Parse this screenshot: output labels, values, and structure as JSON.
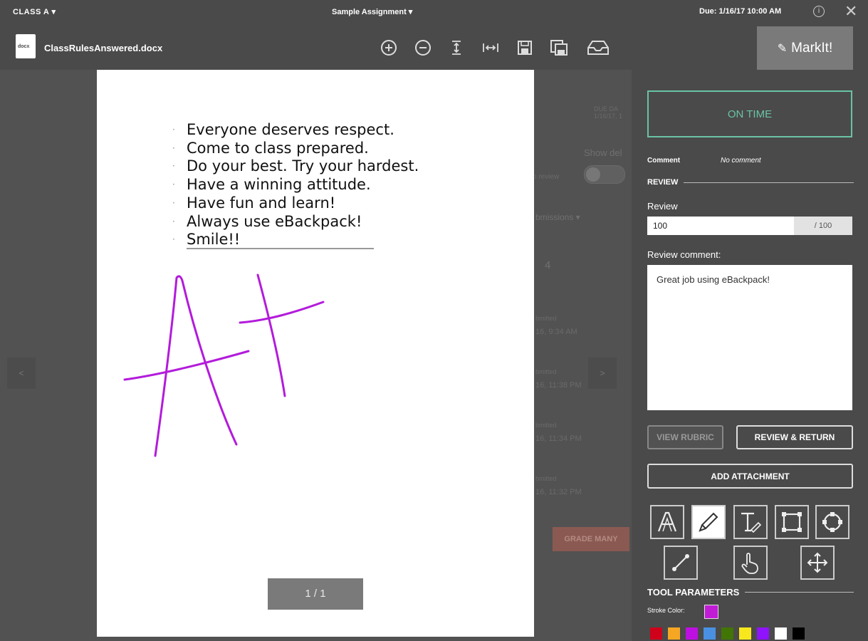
{
  "topbar": {
    "class_label": "CLASS A ▾",
    "assignment_label": "Sample Assignment ▾",
    "due_label": "Due: 1/16/17 10:00 AM",
    "info_glyph": "i",
    "close_glyph": "✕"
  },
  "toolbar": {
    "file_ext": "docx",
    "file_name": "ClassRulesAnswered.docx",
    "icons": [
      "zoom-in-icon",
      "zoom-out-icon",
      "fit-height-icon",
      "fit-width-icon",
      "save-icon",
      "save-copy-icon",
      "inbox-icon"
    ],
    "markit_label": "MarkIt!"
  },
  "background": {
    "due_date_header": "DUE DA",
    "due_date_value": "1/16/17, 1",
    "show_label": "Show del",
    "review_text": "o review",
    "submissions_label": "bmissions ▾",
    "count": "4",
    "items": [
      {
        "status": "bmitted",
        "time": "16, 9:34 AM"
      },
      {
        "status": "bmitted",
        "time": "16, 11:38 PM"
      },
      {
        "status": "bmitted",
        "time": "16, 11:34 PM"
      },
      {
        "status": "bmitted",
        "time": "16, 11:32 PM"
      }
    ],
    "grade_many_label": "GRADE MANY",
    "prev_glyph": "<",
    "next_glyph": ">"
  },
  "document": {
    "rules": [
      "Everyone deserves respect.",
      "Come to class prepared.",
      "Do your best.  Try your hardest.",
      "Have a winning attitude.",
      "Have fun and learn!",
      "Always use eBackpack!",
      " Smile!!"
    ],
    "ink_color": "#b31bdb",
    "pager": "1 / 1"
  },
  "panel": {
    "status": "ON TIME",
    "status_color": "#6ac3a3",
    "comment_label": "Comment",
    "comment_value": "No comment",
    "review_section": "REVIEW",
    "review_label": "Review",
    "review_value": "100",
    "review_max": "/ 100",
    "review_comment_label": "Review comment:",
    "review_comment_value": "Great job using eBackpack!",
    "view_rubric": "VIEW RUBRIC",
    "review_return": "REVIEW & RETURN",
    "add_attachment": "ADD ATTACHMENT",
    "tools": [
      "text-annotation-icon",
      "pencil-icon",
      "text-tool-icon",
      "rectangle-icon",
      "ellipse-icon",
      "line-icon",
      "hand-icon",
      "move-icon"
    ],
    "tool_params_label": "TOOL PARAMETERS",
    "stroke_color_label": "Stroke Color:",
    "stroke_color": "#c21bd6",
    "swatches": [
      "#d0021b",
      "#f5a623",
      "#bd10e0",
      "#4a90e2",
      "#417505",
      "#f8e71c",
      "#9013fe",
      "#ffffff",
      "#000000"
    ]
  }
}
